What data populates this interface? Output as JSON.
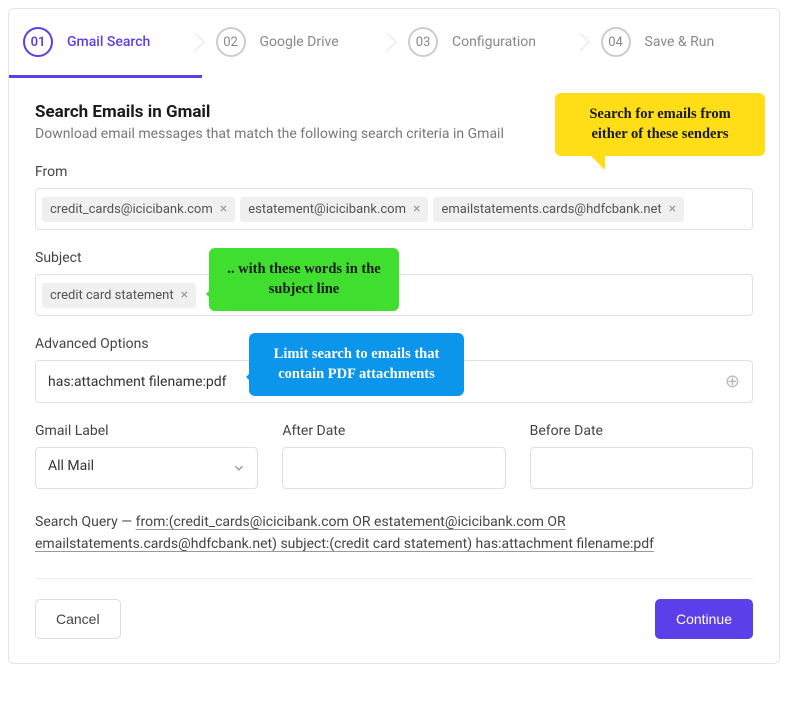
{
  "steps": [
    {
      "num": "01",
      "label": "Gmail Search"
    },
    {
      "num": "02",
      "label": "Google Drive"
    },
    {
      "num": "03",
      "label": "Configuration"
    },
    {
      "num": "04",
      "label": "Save & Run"
    }
  ],
  "heading": "Search Emails in Gmail",
  "subheading": "Download email messages that match the following search criteria in Gmail",
  "labels": {
    "from": "From",
    "subject": "Subject",
    "advanced": "Advanced Options",
    "gmail_label": "Gmail Label",
    "after_date": "After Date",
    "before_date": "Before Date",
    "search_query_prefix": "Search Query — "
  },
  "from_chips": [
    "credit_cards@icicibank.com",
    "estatement@icicibank.com",
    "emailstatements.cards@hdfcbank.net"
  ],
  "subject_chips": [
    "credit card statement"
  ],
  "advanced_value": "has:attachment filename:pdf",
  "gmail_label_value": "All Mail",
  "search_query": "from:(credit_cards@icicibank.com OR estatement@icicibank.com OR emailstatements.cards@hdfcbank.net) subject:(credit card statement) has:attachment filename:pdf",
  "buttons": {
    "cancel": "Cancel",
    "continue": "Continue"
  },
  "callouts": {
    "yellow": "Search for emails from either of these senders",
    "green": ".. with these words in the subject line",
    "blue": "Limit search to emails that contain PDF attachments"
  }
}
